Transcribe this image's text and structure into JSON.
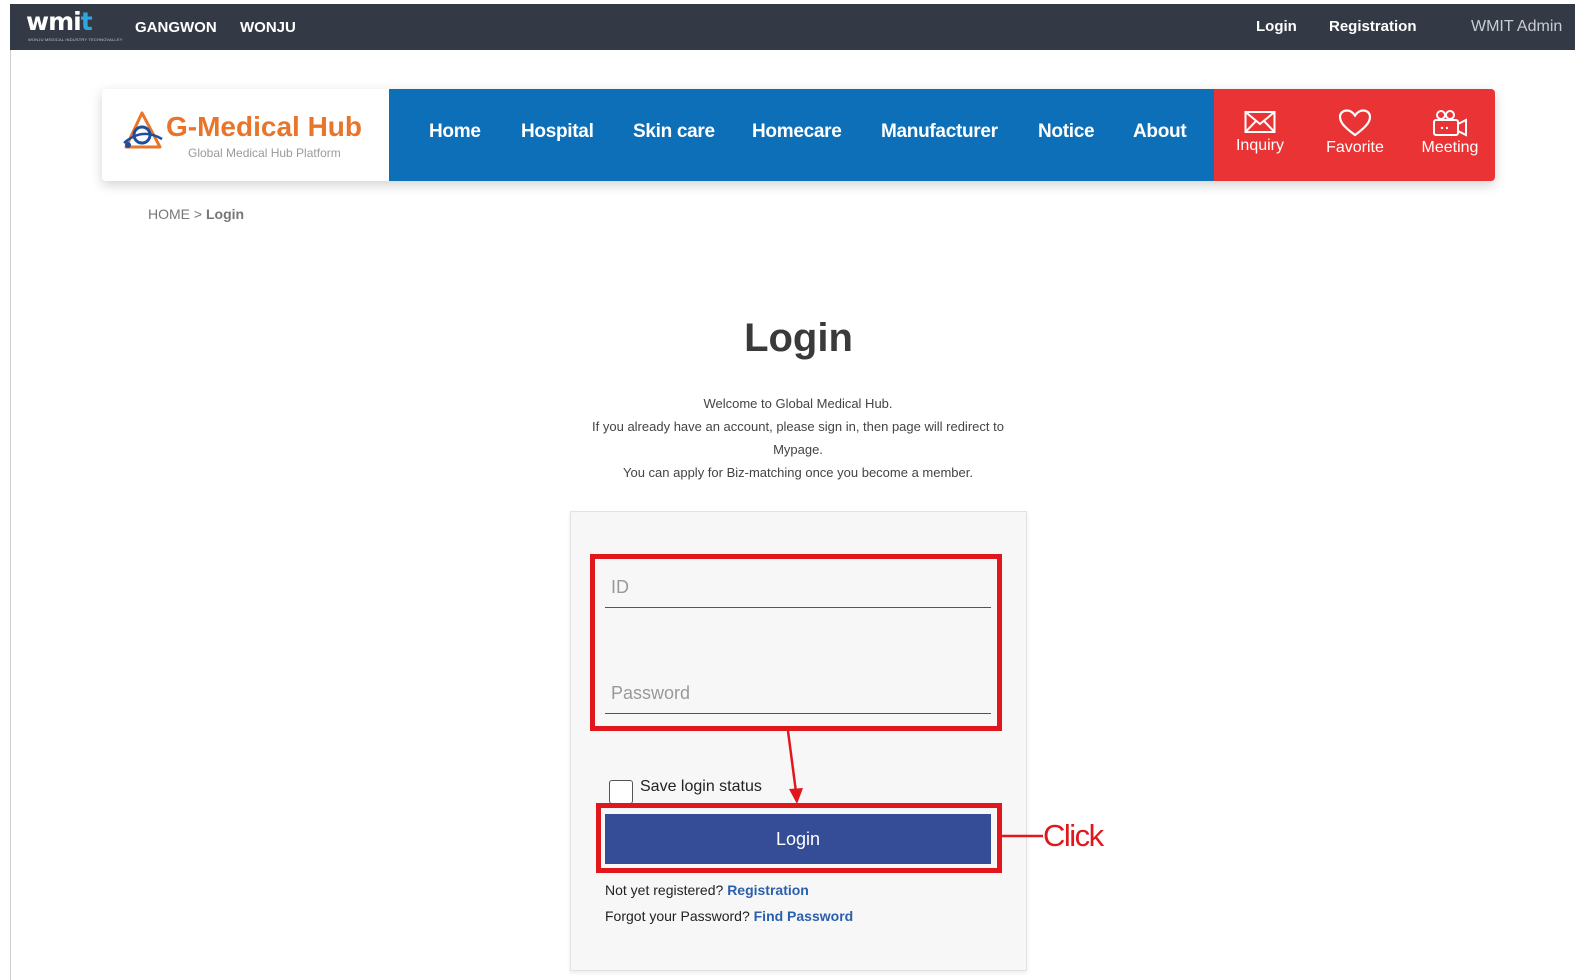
{
  "topbar": {
    "logo": "wmi",
    "logo_t": "t",
    "logo_sub": "WONJU MEDICAL INDUSTRY TECHNOVALLEY",
    "regions": [
      "GANGWON",
      "WONJU"
    ],
    "login_link": "Login",
    "registration_link": "Registration",
    "admin": "WMIT Admin"
  },
  "brand": {
    "name": "G-Medical Hub",
    "tagline": "Global Medical Hub Platform",
    "colors": {
      "orange": "#e9752a",
      "nav_blue": "#0d6fb8",
      "quick_red": "#e93334"
    }
  },
  "nav": {
    "items": [
      "Home",
      "Hospital",
      "Skin care",
      "Homecare",
      "Manufacturer",
      "Notice",
      "About"
    ]
  },
  "quick": [
    {
      "icon": "envelope-icon",
      "label": "Inquiry"
    },
    {
      "icon": "heart-icon",
      "label": "Favorite"
    },
    {
      "icon": "video-camera-icon",
      "label": "Meeting"
    }
  ],
  "breadcrumb": {
    "home": "HOME",
    "sep": " > ",
    "current": "Login"
  },
  "login": {
    "title": "Login",
    "intro": [
      "Welcome to Global Medical Hub.",
      "If you already have an account, please sign in, then page will redirect to",
      "Mypage.",
      "You can apply for Biz-matching once you become a member."
    ],
    "id_placeholder": "ID",
    "password_placeholder": "Password",
    "save_label": "Save login status",
    "button_label": "Login",
    "not_registered": "Not yet registered?",
    "registration_link": "Registration",
    "forgot": "Forgot your Password?",
    "find_password_link": "Find Password",
    "button_color": "#354d96"
  },
  "annotation": {
    "label": "Click",
    "color": "#e0181d"
  }
}
